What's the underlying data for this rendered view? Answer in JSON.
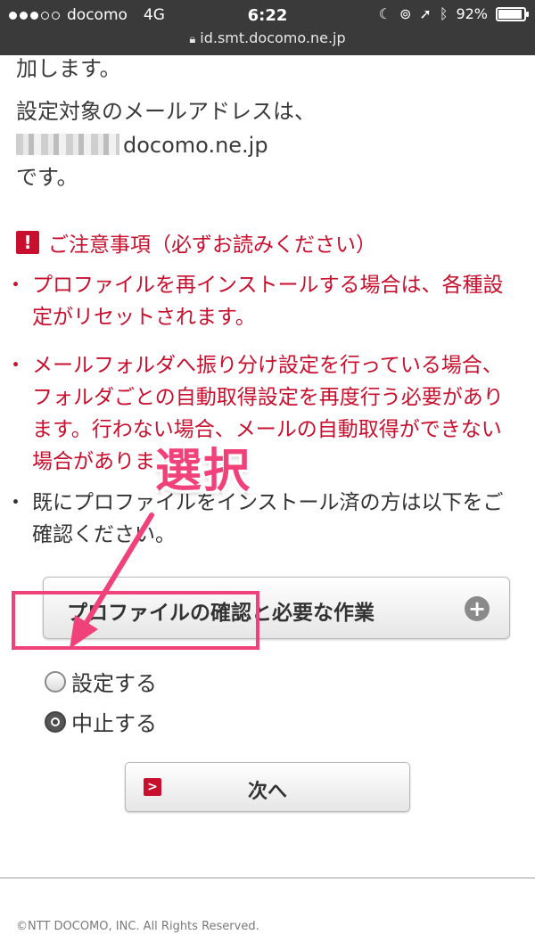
{
  "status_bar": {
    "carrier": "docomo",
    "network": "4G",
    "time": "6:22",
    "battery": "92%",
    "battery_level": 0.92,
    "signal_bars": 3,
    "url": "id.smt.docomo.ne.jp"
  },
  "content": {
    "intro_tail": "加します。",
    "address_line1": "設定対象のメールアドレスは、",
    "address_domain": "docomo.ne.jp",
    "address_line3": "です。",
    "notice_title": "ご注意事項（必ずお読みください）",
    "notice_icon": "!",
    "bullets": [
      "プロファイルを再インストールする場合は、各種設定がリセットされます。",
      "メールフォルダへ振り分け設定を行っている場合、フォルダごとの自動取得設定を再度行う必要があります。行わない場合、メールの自動取得ができない場合があります。",
      "既にプロファイルをインストール済の方は以下をご確認ください。"
    ],
    "accordion_label": "プロファイルの確認と必要な作業",
    "radio_options": [
      {
        "label": "設定する",
        "checked": false
      },
      {
        "label": "中止する",
        "checked": true
      }
    ],
    "next_button": "次へ",
    "footer": "©NTT DOCOMO, INC. All Rights Reserved."
  },
  "annotation": {
    "callout": "選択",
    "color": "#f0417a"
  },
  "colors": {
    "accent_red": "#c8102e",
    "status_bar_bg": "#3a3a3a"
  }
}
